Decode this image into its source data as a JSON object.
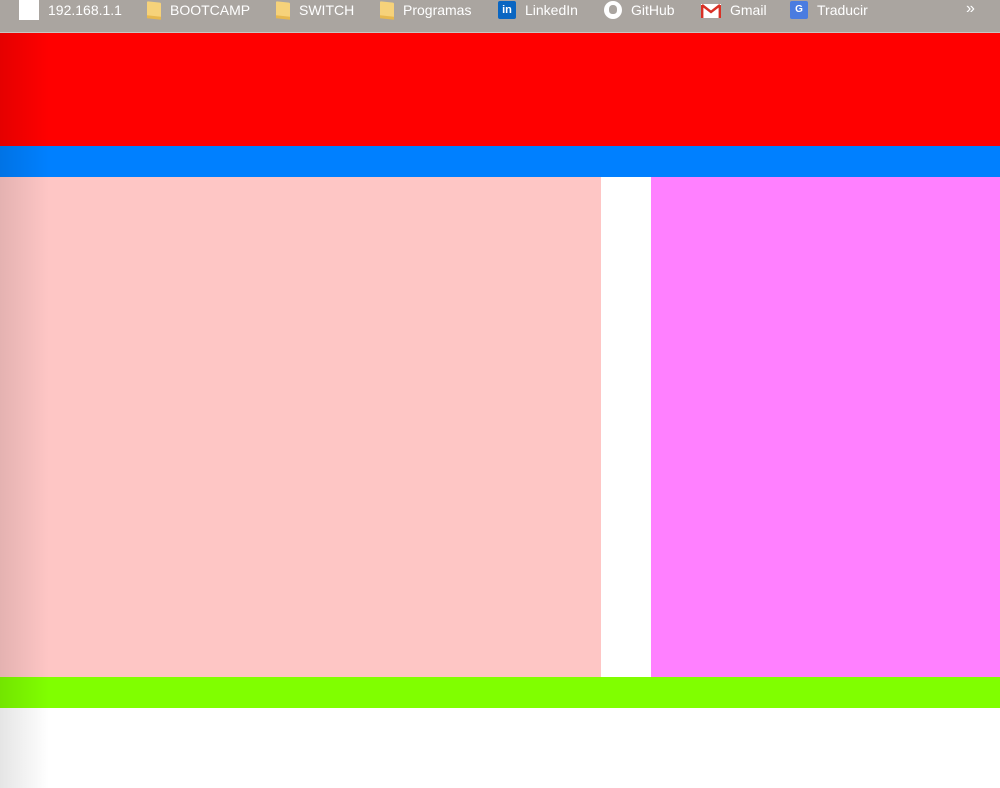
{
  "bookmarks": {
    "items": [
      {
        "label": "192.168.1.1",
        "icon": "blank-page-icon"
      },
      {
        "label": "BOOTCAMP",
        "icon": "folder-icon"
      },
      {
        "label": "SWITCH",
        "icon": "folder-icon"
      },
      {
        "label": "Programas",
        "icon": "folder-icon"
      },
      {
        "label": "LinkedIn",
        "icon": "linkedin-icon"
      },
      {
        "label": "GitHub",
        "icon": "github-icon"
      },
      {
        "label": "Gmail",
        "icon": "gmail-icon"
      },
      {
        "label": "Traducir",
        "icon": "translate-icon"
      }
    ],
    "overflow": "»"
  },
  "colors": {
    "header": "#ff0000",
    "nav": "#0080ff",
    "main": "#fec6c5",
    "gap": "#ffffff",
    "aside": "#ff80ff",
    "footer": "#80ff00"
  }
}
